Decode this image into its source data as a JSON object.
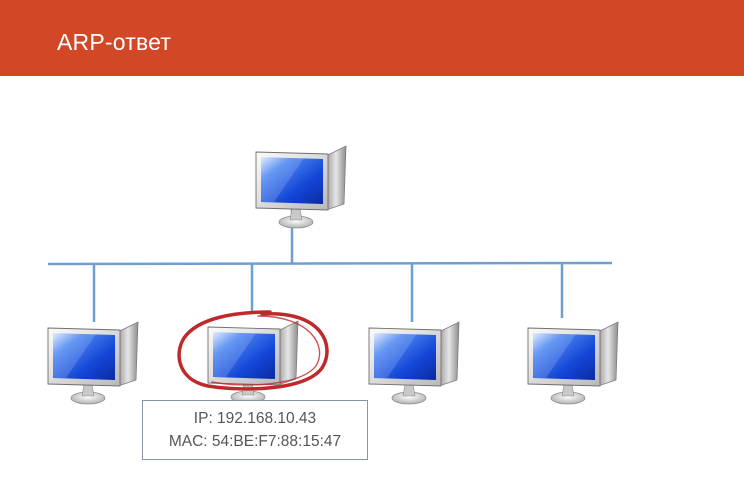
{
  "header": {
    "title": "ARP-ответ",
    "background": "#d24726"
  },
  "network": {
    "bus_color": "#6f9fcf",
    "highlight_color": "#c0282b",
    "computers": [
      {
        "role": "top",
        "icon": "monitor-icon"
      },
      {
        "role": "bottom-1",
        "icon": "monitor-icon"
      },
      {
        "role": "bottom-2",
        "icon": "monitor-icon",
        "highlighted": true
      },
      {
        "role": "bottom-3",
        "icon": "monitor-icon"
      },
      {
        "role": "bottom-4",
        "icon": "monitor-icon"
      }
    ]
  },
  "info": {
    "ip": "IP: 192.168.10.43",
    "mac": "MAC:  54:BE:F7:88:15:47"
  }
}
